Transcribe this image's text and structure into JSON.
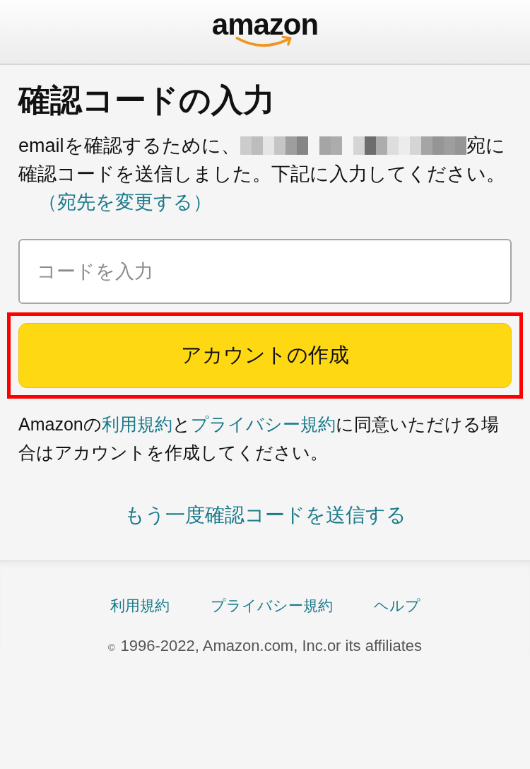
{
  "header": {
    "logo": "amazon"
  },
  "title": "確認コードの入力",
  "intro": {
    "before": "emailを確認するために、",
    "after": "宛に確認コードを送信しました。下記に入力してください。",
    "link": "（宛先を変更する）"
  },
  "code_field": {
    "placeholder": "コードを入力"
  },
  "create_button": {
    "label": "アカウントの作成",
    "highlighted": true
  },
  "agreement": [
    {
      "kind": "text",
      "text": "Amazonの"
    },
    {
      "kind": "link",
      "text": "利用規約"
    },
    {
      "kind": "text",
      "text": "と"
    },
    {
      "kind": "link",
      "text": "プライバシー規約"
    },
    {
      "kind": "text",
      "text": "に同意いただける場合はアカウントを作成してください。"
    }
  ],
  "resend_link": "もう一度確認コードを送信する",
  "footer": {
    "links": [
      "利用規約",
      "プライバシー規約",
      "ヘルプ"
    ],
    "copyright_mark": "©",
    "copyright": "1996-2022, Amazon.com, Inc.or its affiliates"
  }
}
